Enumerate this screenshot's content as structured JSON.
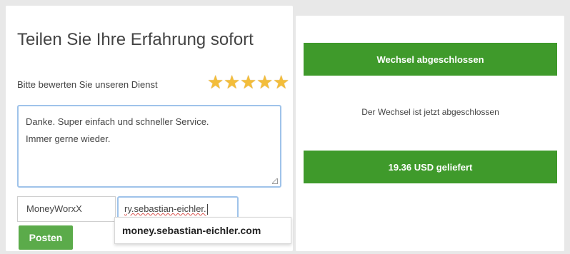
{
  "review": {
    "title": "Teilen Sie Ihre Erfahrung sofort",
    "rating_label": "Bitte bewerten Sie unseren Dienst",
    "rating": 5,
    "rating_max": 5,
    "star_color": "#f3bd3a",
    "comment_line_1": "Danke. Super einfach und schneller Service.",
    "comment_line_2": "Immer gerne wieder.",
    "name_value": "MoneyWorxX",
    "url_value": "ry.sebastian-eichler.",
    "autocomplete_suggestion": "money.sebastian-eichler.com",
    "post_button_label": "Posten",
    "post_button_color": "#5bab4a"
  },
  "exchange": {
    "status_banner": "Wechsel abgeschlossen",
    "status_message": "Der Wechsel ist jetzt abgeschlossen",
    "delivered_banner": "19.36 USD geliefert",
    "banner_color": "#3f9a2b"
  }
}
